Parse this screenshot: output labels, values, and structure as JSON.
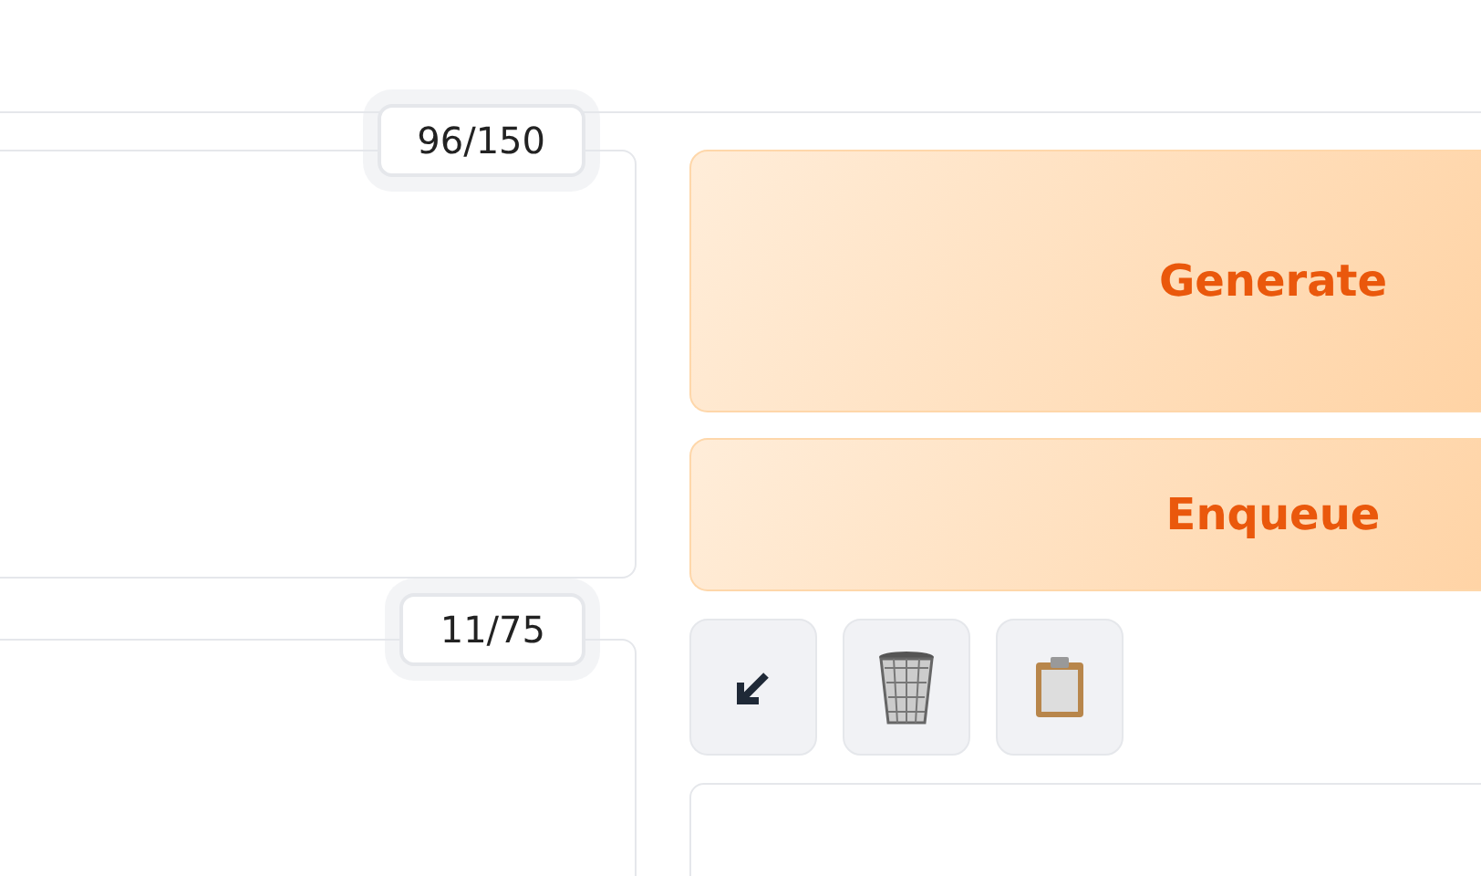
{
  "prompts": [
    {
      "counter": "96/150"
    },
    {
      "counter": "11/75"
    }
  ],
  "buttons": [
    {
      "label": "Generate"
    },
    {
      "label": "Enqueue"
    }
  ],
  "tools": [
    {
      "kind": "arrow"
    },
    {
      "kind": "trash"
    },
    {
      "kind": "clipboard"
    }
  ]
}
